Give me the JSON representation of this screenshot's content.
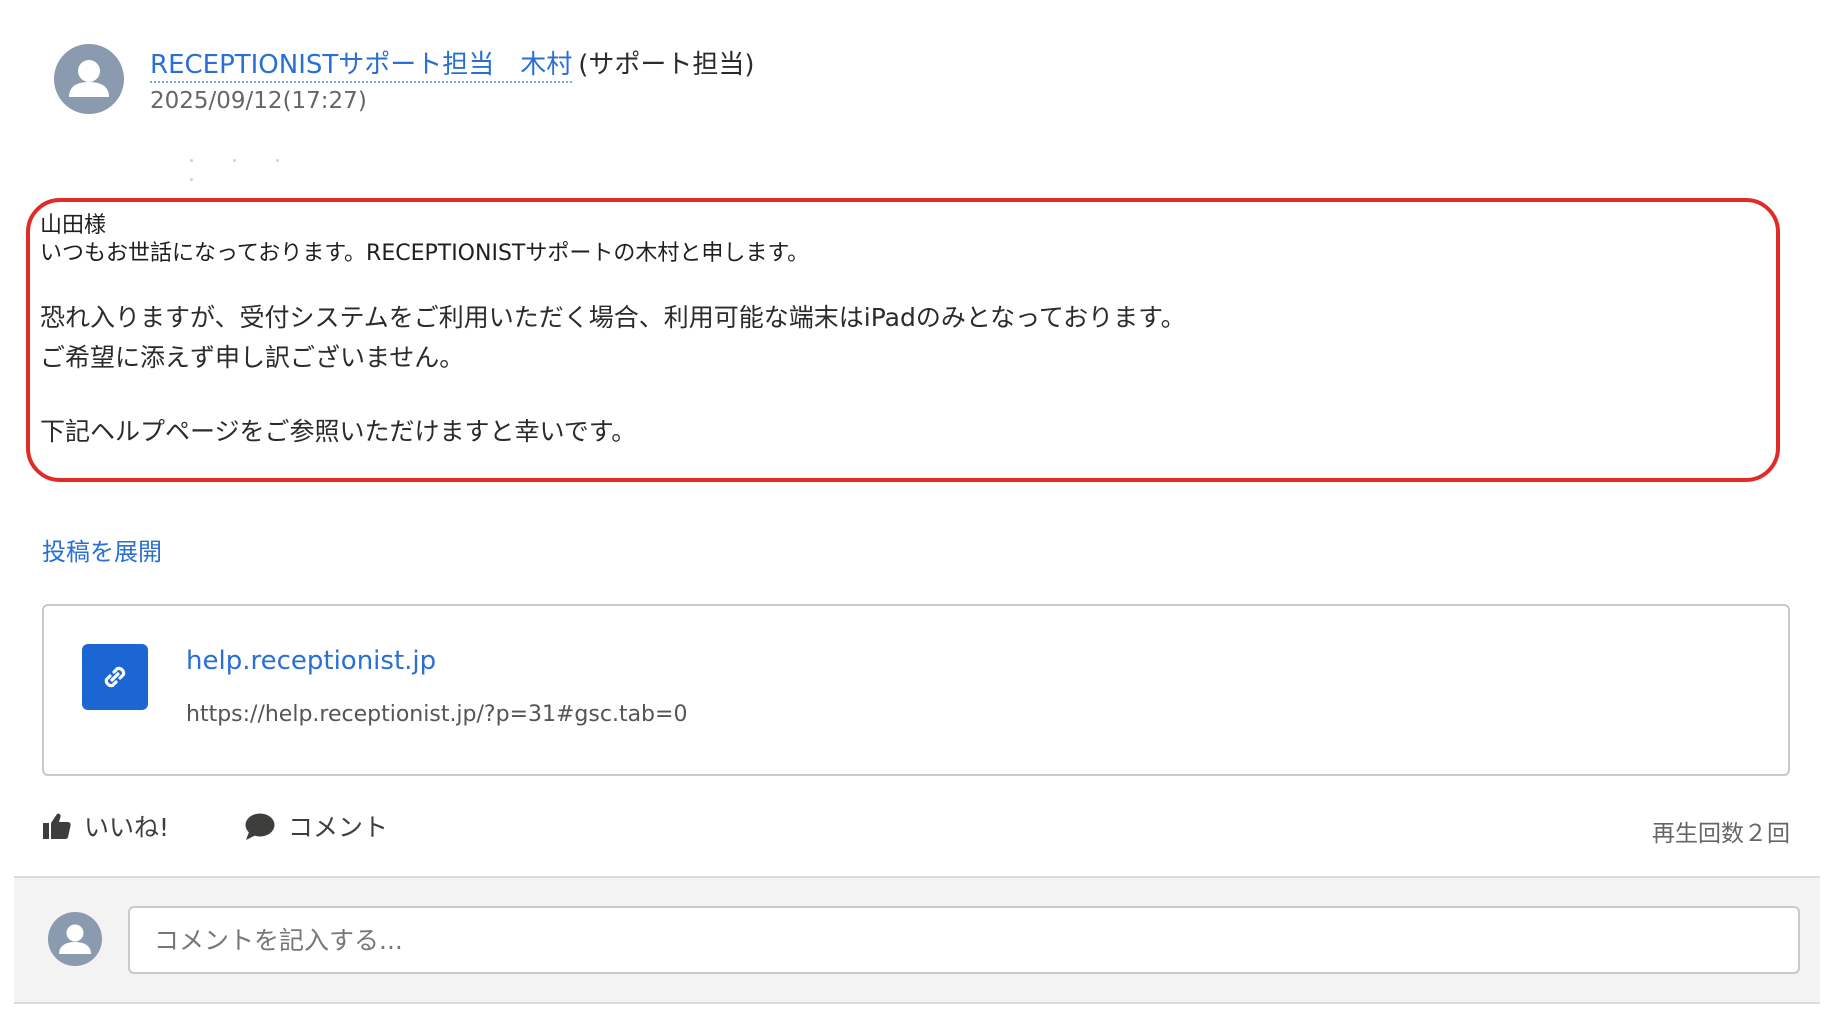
{
  "post": {
    "author_name": "RECEPTIONISTサポート担当　木村",
    "author_role": "(サポート担当)",
    "date": "2025/09/12(17:27)",
    "body": {
      "line1": "山田様",
      "line2": "いつもお世話になっております。RECEPTIONISTサポートの木村と申します。",
      "line3": "恐れ入りますが、受付システムをご利用いただく場合、利用可能な端末はiPadのみとなっております。",
      "line4": "ご希望に添えず申し訳ございません。",
      "line5": "下記ヘルプページをご参照いただけますと幸いです。"
    },
    "expand_label": "投稿を展開",
    "highlight_color": "#e02b27"
  },
  "link_card": {
    "title": "help.receptionist.jp",
    "url": "https://help.receptionist.jp/?p=31#gsc.tab=0",
    "icon": "link-icon",
    "icon_color": "#1b66d2"
  },
  "actions": {
    "like_label": "いいね!",
    "comment_label": "コメント",
    "views": "再生回数２回"
  },
  "comment_box": {
    "placeholder": "コメントを記入する..."
  },
  "colors": {
    "link": "#2a6fd6",
    "avatar": "#8a9bb0"
  }
}
